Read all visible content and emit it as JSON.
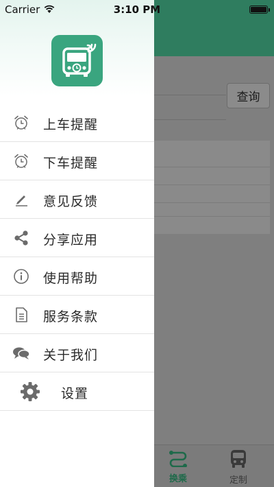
{
  "status_bar": {
    "carrier": "Carrier",
    "time": "3:10 PM"
  },
  "background": {
    "query_button": "查询",
    "tabs": [
      {
        "label": "换乘",
        "icon": "route-icon",
        "active": true
      },
      {
        "label": "定制",
        "icon": "bus-icon",
        "active": false
      }
    ]
  },
  "drawer": {
    "logo_icon": "bus-alarm-logo",
    "items": [
      {
        "label": "上车提醒",
        "icon": "alarm-clock-icon"
      },
      {
        "label": "下车提醒",
        "icon": "alarm-clock-icon"
      },
      {
        "label": "意见反馈",
        "icon": "pencil-icon"
      },
      {
        "label": "分享应用",
        "icon": "share-icon"
      },
      {
        "label": "使用帮助",
        "icon": "info-icon"
      },
      {
        "label": "服务条款",
        "icon": "document-icon"
      },
      {
        "label": "关于我们",
        "icon": "chat-bubbles-icon"
      },
      {
        "label": "设置",
        "icon": "gear-icon"
      }
    ]
  },
  "colors": {
    "brand_green": "#3aa57f",
    "header_green_dimmed": "#2f7d5f",
    "active_tab": "#1e6a4a"
  }
}
